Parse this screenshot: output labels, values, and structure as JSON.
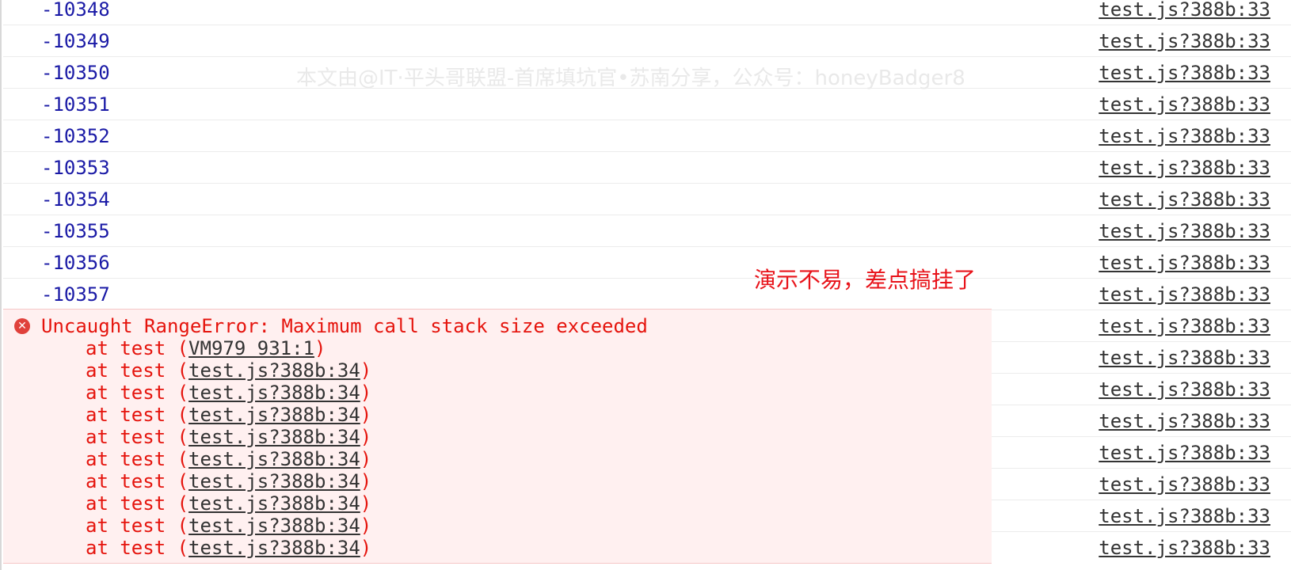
{
  "console": {
    "log_rows": [
      {
        "value": "-10348",
        "source": "test.js?388b:33"
      },
      {
        "value": "-10349",
        "source": "test.js?388b:33"
      },
      {
        "value": "-10350",
        "source": "test.js?388b:33"
      },
      {
        "value": "-10351",
        "source": "test.js?388b:33"
      },
      {
        "value": "-10352",
        "source": "test.js?388b:33"
      },
      {
        "value": "-10353",
        "source": "test.js?388b:33"
      },
      {
        "value": "-10354",
        "source": "test.js?388b:33"
      },
      {
        "value": "-10355",
        "source": "test.js?388b:33"
      },
      {
        "value": "-10356",
        "source": "test.js?388b:33"
      },
      {
        "value": "-10357",
        "source": "test.js?388b:33"
      }
    ],
    "error_row_sources": [
      "test.js?388b:33",
      "test.js?388b:33",
      "test.js?388b:33",
      "test.js?388b:33",
      "test.js?388b:33",
      "test.js?388b:33",
      "test.js?388b:33",
      "test.js?388b:33"
    ],
    "error": {
      "icon": "error-circle-icon",
      "message": "Uncaught RangeError: Maximum call stack size exceeded",
      "stack": [
        {
          "prefix": "at test (",
          "link": "VM979 931:1",
          "suffix": ")"
        },
        {
          "prefix": "at test (",
          "link": "test.js?388b:34",
          "suffix": ")"
        },
        {
          "prefix": "at test (",
          "link": "test.js?388b:34",
          "suffix": ")"
        },
        {
          "prefix": "at test (",
          "link": "test.js?388b:34",
          "suffix": ")"
        },
        {
          "prefix": "at test (",
          "link": "test.js?388b:34",
          "suffix": ")"
        },
        {
          "prefix": "at test (",
          "link": "test.js?388b:34",
          "suffix": ")"
        },
        {
          "prefix": "at test (",
          "link": "test.js?388b:34",
          "suffix": ")"
        },
        {
          "prefix": "at test (",
          "link": "test.js?388b:34",
          "suffix": ")"
        },
        {
          "prefix": "at test (",
          "link": "test.js?388b:34",
          "suffix": ")"
        },
        {
          "prefix": "at test (",
          "link": "test.js?388b:34",
          "suffix": ")"
        }
      ]
    }
  },
  "watermark": "本文由@IT·平头哥联盟-首席填坑官•苏南分享，公众号：honeyBadger8",
  "annotation": "演示不易，差点搞挂了",
  "colors": {
    "log_value": "#1a1aa6",
    "error_text": "#e5140d",
    "error_background": "#fff0f0",
    "link": "#333333",
    "annotation": "#e8131a"
  }
}
